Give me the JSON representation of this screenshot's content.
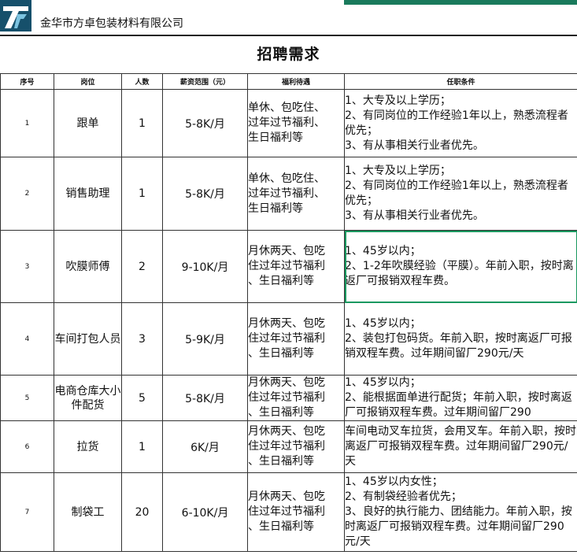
{
  "header": {
    "logo_icon": "company-logo-icon",
    "company_name": "金华市方卓包装材料有限公司",
    "accent_color": "#1a7a5c"
  },
  "title": "招聘需求",
  "table": {
    "columns": [
      "序号",
      "岗位",
      "人数",
      "薪资范围（元）",
      "福利待遇",
      "任职条件"
    ],
    "rows": [
      {
        "idx": "1",
        "position": "跟单",
        "count": "1",
        "salary": "5-8K/月",
        "benefits": [
          "单休、包吃住、",
          "过年过节福利、",
          "生日福利等"
        ],
        "requirements": [
          "1、大专及以上学历；",
          "2、有同岗位的工作经验1年以上，熟悉流程者优先；",
          "3、有从事相关行业者优先。"
        ]
      },
      {
        "idx": "2",
        "position": "销售助理",
        "count": "1",
        "salary": "5-8K/月",
        "benefits": [
          "单休、包吃住、",
          "过年过节福利、",
          "生日福利等"
        ],
        "requirements": [
          "1、大专及以上学历；",
          "2、有同岗位的工作经验1年以上，熟悉流程者优先；",
          "3、有从事相关行业者优先。"
        ]
      },
      {
        "idx": "3",
        "position": "吹膜师傅",
        "count": "2",
        "salary": "9-10K/月",
        "benefits": [
          "月休两天、包吃",
          "住过年过节福利",
          "、生日福利等"
        ],
        "requirements": [
          "1、45岁以内；",
          "2、1-2年吹膜经验（平膜）。年前入职，按时离返厂可报销双程车费。"
        ]
      },
      {
        "idx": "4",
        "position": "车间打包人员",
        "count": "3",
        "salary": "5-9K/月",
        "benefits": [
          "月休两天、包吃",
          "住过年过节福利",
          "、生日福利等"
        ],
        "requirements": [
          "1、45岁以内；",
          "2、装包打包码货。年前入职，按时离返厂可报销双程车费。过年期间留厂290元/天"
        ]
      },
      {
        "idx": "5",
        "position": "电商仓库大小件配货",
        "count": "5",
        "salary": "5-8K/月",
        "benefits": [
          "月休两天、包吃",
          "住过年过节福利",
          "、生日福利等"
        ],
        "requirements": [
          "1、45岁以内；",
          "2、能根据面单进行配货；年前入职，按时离返厂可报销双程车费。过年期间留厂290"
        ]
      },
      {
        "idx": "6",
        "position": "拉货",
        "count": "1",
        "salary": "6K/月",
        "benefits": [
          "月休两天、包吃",
          "住过年过节福利",
          "、生日福利等"
        ],
        "requirements": [
          "车间电动叉车拉货，会用叉车。年前入职，按时离返厂可报销双程车费。过年期间留厂290元/天"
        ]
      },
      {
        "idx": "7",
        "position": "制袋工",
        "count": "20",
        "salary": "6-10K/月",
        "benefits": [
          "月休两天、包吃",
          "住过年过节福利",
          "、生日福利等"
        ],
        "requirements": [
          "1、45岁以内女性；",
          "2、有制袋经验者优先；",
          "3、良好的执行能力、团结能力。年前入职，按时离返厂可报销双程车费。过年期间留厂290元/天"
        ]
      }
    ]
  }
}
